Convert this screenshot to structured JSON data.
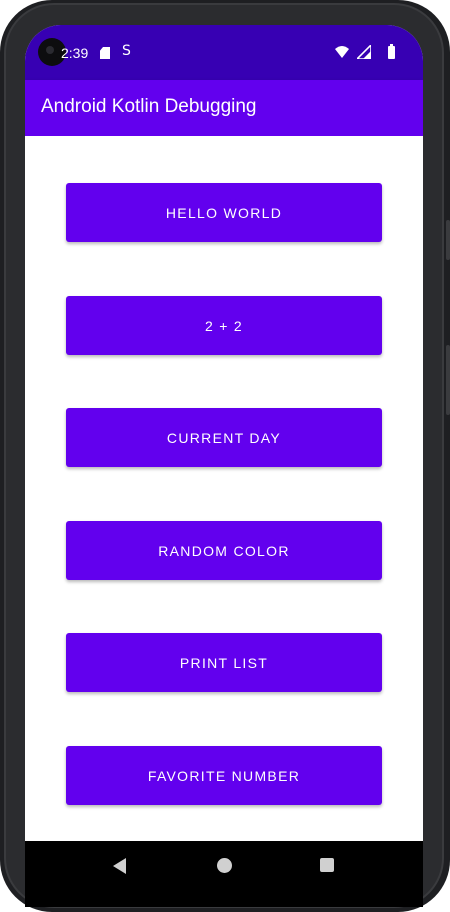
{
  "status_bar": {
    "time": "2:39",
    "icons": [
      "camera-icon",
      "sd-card-icon",
      "s-notification-icon",
      "wifi-icon",
      "signal-icon",
      "battery-icon"
    ],
    "s_glyph": "S"
  },
  "app_bar": {
    "title": "Android Kotlin Debugging"
  },
  "buttons": [
    {
      "label": "HELLO WORLD"
    },
    {
      "label": "2 + 2"
    },
    {
      "label": "CURRENT DAY"
    },
    {
      "label": "RANDOM COLOR"
    },
    {
      "label": "PRINT LIST"
    },
    {
      "label": "FAVORITE NUMBER"
    }
  ],
  "nav_bar": {
    "icons": [
      "back-icon",
      "home-icon",
      "recents-icon"
    ]
  },
  "colors": {
    "status_bar": "#3700b3",
    "primary": "#6200ee",
    "on_primary": "#ffffff",
    "background": "#ffffff"
  }
}
